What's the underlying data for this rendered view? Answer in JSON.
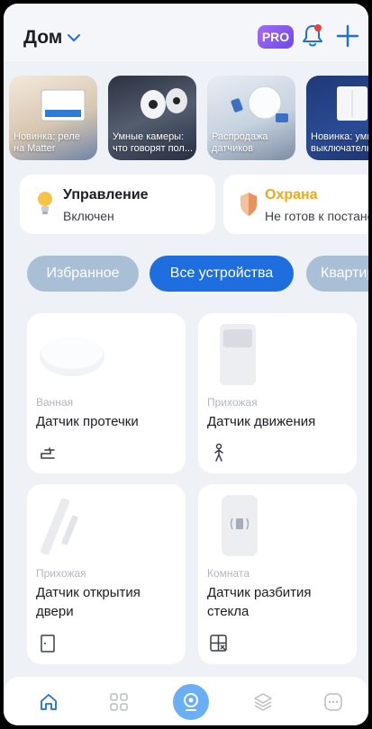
{
  "header": {
    "home_title": "Дом",
    "pro_label": "PRO",
    "icons": [
      "chevron-down-icon",
      "bell-icon",
      "plus-icon"
    ],
    "accent": "#1f6ee0"
  },
  "stories": [
    {
      "caption": "Новинка: реле на Matter"
    },
    {
      "caption": "Умные камеры: что говорят пол..."
    },
    {
      "caption": "Распродажа датчиков"
    },
    {
      "caption": "Новинка: умный выключатель"
    }
  ],
  "status": {
    "control": {
      "title": "Управление",
      "subtitle": "Включен",
      "icon": "lightbulb-icon"
    },
    "guard": {
      "title": "Охрана",
      "subtitle": "Не готов к постановке",
      "icon": "shield-icon",
      "color": "#f2a71c"
    }
  },
  "tabs": [
    {
      "label": "Избранное"
    },
    {
      "label": "Все устройства",
      "active": true
    },
    {
      "label": "Квартира"
    }
  ],
  "devices": [
    {
      "room": "Ванная",
      "name": "Датчик протечки",
      "icon": "faucet-icon"
    },
    {
      "room": "Прихожая",
      "name": "Датчик движения",
      "icon": "person-icon"
    },
    {
      "room": "Прихожая",
      "name": "Датчик открытия двери",
      "icon": "door-icon"
    },
    {
      "room": "Комната",
      "name": "Датчик разбития стекла",
      "icon": "window-icon"
    }
  ],
  "bottom_nav": {
    "items": [
      "home-icon",
      "grid-icon",
      "camera-icon",
      "layers-icon",
      "more-icon"
    ],
    "active": "home-icon"
  }
}
